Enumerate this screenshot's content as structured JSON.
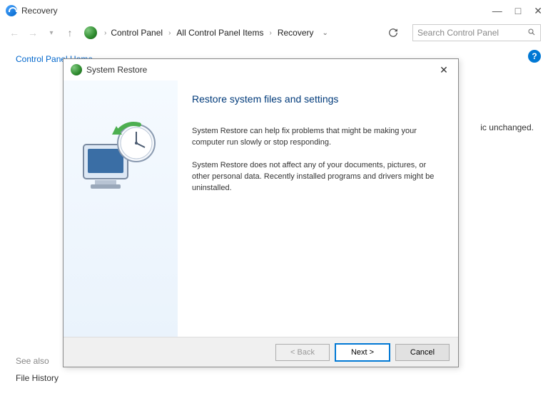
{
  "window": {
    "title": "Recovery",
    "controls": {
      "minimize": "—",
      "maximize": "□",
      "close": "✕"
    }
  },
  "nav": {
    "breadcrumb": [
      "Control Panel",
      "All Control Panel Items",
      "Recovery"
    ],
    "search_placeholder": "Search Control Panel"
  },
  "sidebar": {
    "home": "Control Panel Home",
    "see_also_header": "See also",
    "file_history": "File History"
  },
  "background": {
    "partial_text": "ic unchanged."
  },
  "modal": {
    "title": "System Restore",
    "heading": "Restore system files and settings",
    "para1": "System Restore can help fix problems that might be making your computer run slowly or stop responding.",
    "para2": "System Restore does not affect any of your documents, pictures, or other personal data. Recently installed programs and drivers might be uninstalled.",
    "buttons": {
      "back": "< Back",
      "next": "Next >",
      "cancel": "Cancel"
    }
  }
}
